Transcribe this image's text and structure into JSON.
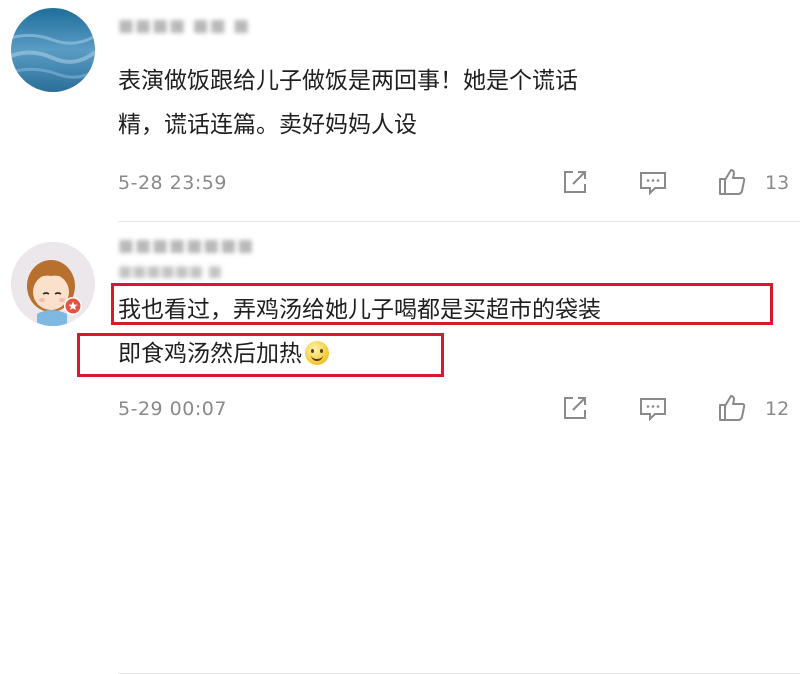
{
  "comments": [
    {
      "text_lines": [
        "表演做饭跟给儿子做饭是两回事！她是个谎话",
        "精，谎话连篇。卖好妈妈人设"
      ],
      "time": "5-28 23:59",
      "likes": "13",
      "icons": {
        "share": "share-icon",
        "comment": "comment-icon",
        "like": "thumbs-up-icon"
      }
    },
    {
      "text_lines": [
        "我也看过，弄鸡汤给她儿子喝都是买超市的袋装",
        "即食鸡汤然后加热"
      ],
      "emoji": "smile-emoji",
      "time": "5-29 00:07",
      "likes": "12",
      "highlight_color": "#d7192b",
      "icons": {
        "share": "share-icon",
        "comment": "comment-icon",
        "like": "thumbs-up-icon"
      }
    }
  ]
}
